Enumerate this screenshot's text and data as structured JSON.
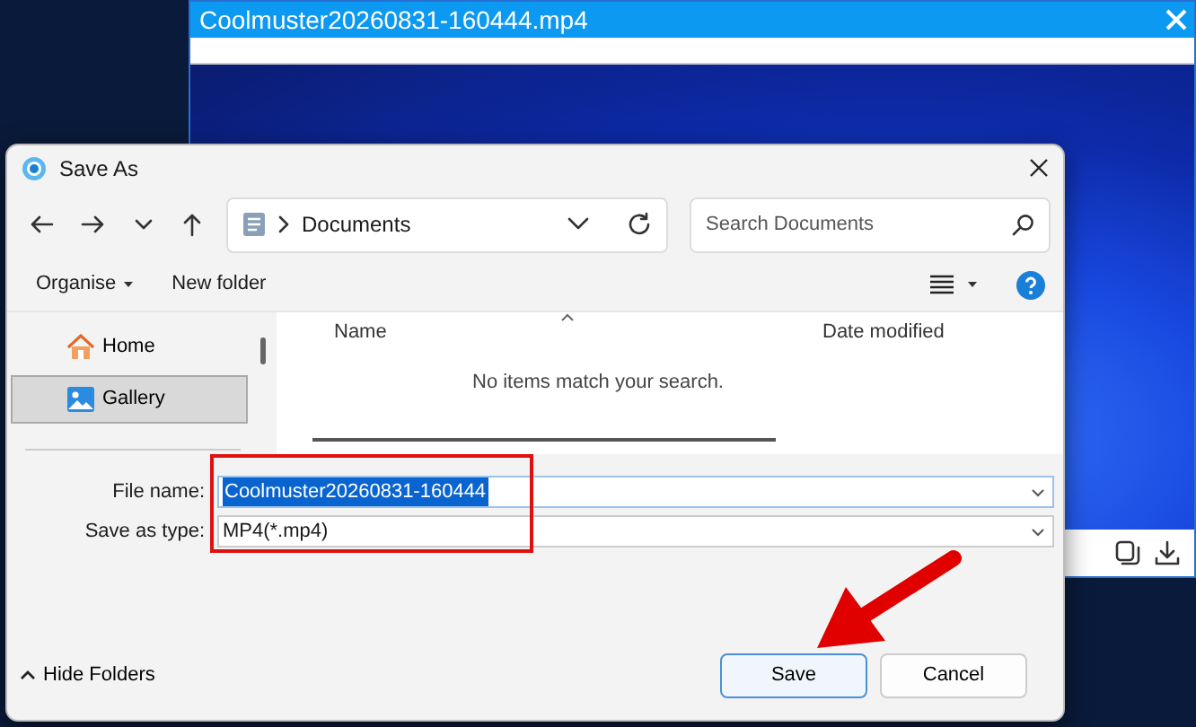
{
  "video_window": {
    "title": "Coolmuster20260831-160444.mp4"
  },
  "dialog": {
    "title": "Save As",
    "address": {
      "path": "Documents"
    },
    "search": {
      "placeholder": "Search Documents"
    },
    "toolbar": {
      "organise": "Organise",
      "new_folder": "New folder"
    },
    "sidebar": {
      "items": [
        {
          "label": "Home",
          "kind": "home",
          "selected": false
        },
        {
          "label": "Gallery",
          "kind": "gallery",
          "selected": true
        }
      ]
    },
    "columns": [
      "Name",
      "Date modified"
    ],
    "empty_message": "No items match your search.",
    "file_name": {
      "label": "File name:",
      "value": "Coolmuster20260831-160444",
      "selected": true
    },
    "save_as_type": {
      "label": "Save as type:",
      "value": "MP4(*.mp4)"
    },
    "hide_folders": "Hide Folders",
    "buttons": [
      {
        "label": "Save",
        "kind": "primary"
      },
      {
        "label": "Cancel",
        "kind": "secondary"
      }
    ]
  }
}
